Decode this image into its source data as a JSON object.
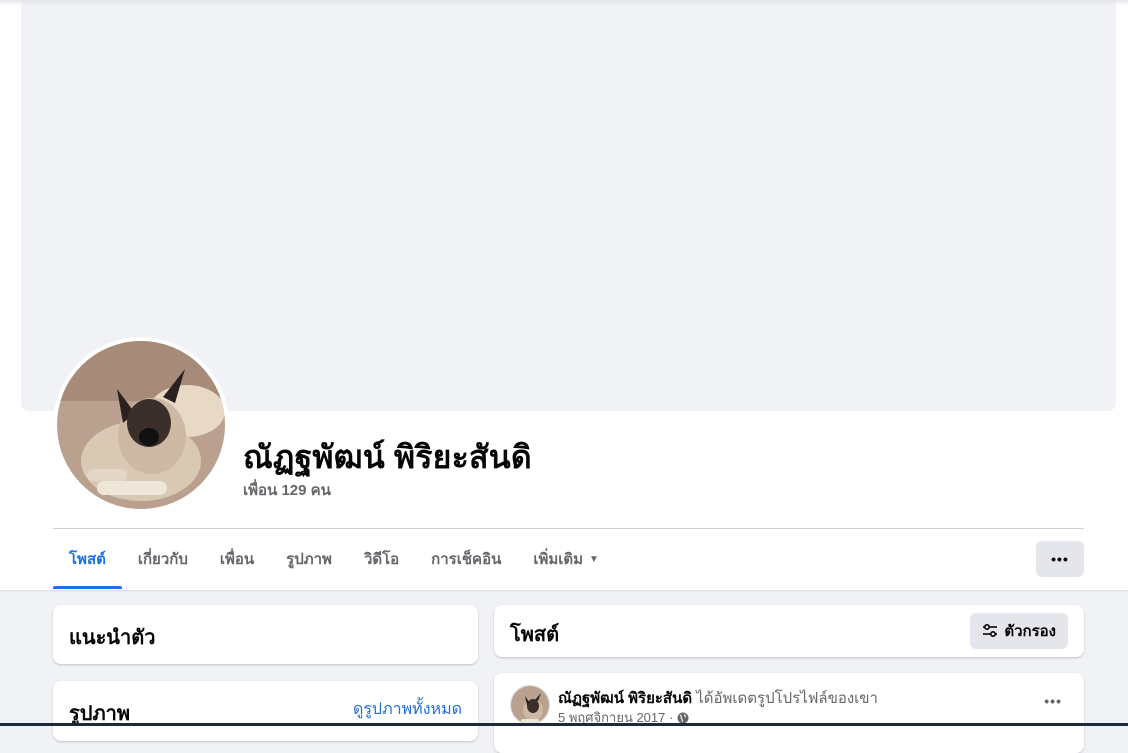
{
  "profile": {
    "name": "ณัฏฐพัฒน์ พิริยะสันดิ",
    "friends": "เพื่อน 129 คน"
  },
  "tabs": [
    {
      "label": "โพสต์",
      "active": true
    },
    {
      "label": "เกี่ยวกับ"
    },
    {
      "label": "เพื่อน"
    },
    {
      "label": "รูปภาพ"
    },
    {
      "label": "วิดีโอ"
    },
    {
      "label": "การเช็คอิน"
    },
    {
      "label": "เพิ่มเติม",
      "caret": "▼"
    }
  ],
  "more_button": "•••",
  "intro": {
    "title": "แนะนำตัว"
  },
  "photos": {
    "title": "รูปภาพ",
    "see_all": "ดูรูปภาพทั้งหมด"
  },
  "posts": {
    "title": "โพสต์",
    "filter_label": "ตัวกรอง",
    "filter_icon": "sliders-icon"
  },
  "post": {
    "author": "ณัฏฐพัฒน์ พิริยะสันดิ",
    "action": "ได้อัพเดตรูปโปรไฟล์ของเขา",
    "date": "5 พฤศจิกายน 2017 ·",
    "privacy_icon": "globe-icon",
    "more": "•••"
  },
  "colors": {
    "accent": "#1b74e4",
    "background": "#f0f2f5",
    "secondary_text": "#65676b"
  }
}
